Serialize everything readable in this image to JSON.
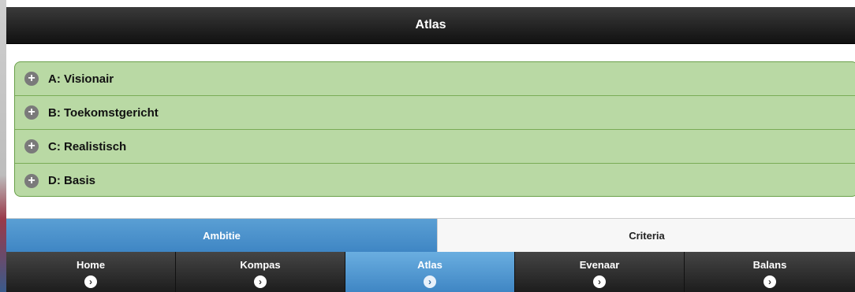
{
  "header": {
    "title": "Atlas"
  },
  "accordion": {
    "items": [
      {
        "label": "A: Visionair",
        "icon": "plus-icon"
      },
      {
        "label": "B: Toekomstgericht",
        "icon": "plus-icon"
      },
      {
        "label": "C: Realistisch",
        "icon": "plus-icon"
      },
      {
        "label": "D: Basis",
        "icon": "plus-icon"
      }
    ]
  },
  "segment": {
    "ambitie": "Ambitie",
    "criteria": "Criteria",
    "active": "Ambitie"
  },
  "navbar": {
    "items": [
      {
        "label": "Home",
        "icon": "chevron-right-icon"
      },
      {
        "label": "Kompas",
        "icon": "chevron-right-icon"
      },
      {
        "label": "Atlas",
        "icon": "chevron-right-icon"
      },
      {
        "label": "Evenaar",
        "icon": "chevron-right-icon"
      },
      {
        "label": "Balans",
        "icon": "chevron-right-icon"
      }
    ],
    "active": "Atlas"
  },
  "colors": {
    "accordion_bg": "#b9d9a4",
    "active_blue": "#4a92cc",
    "header_bg": "#111111"
  }
}
